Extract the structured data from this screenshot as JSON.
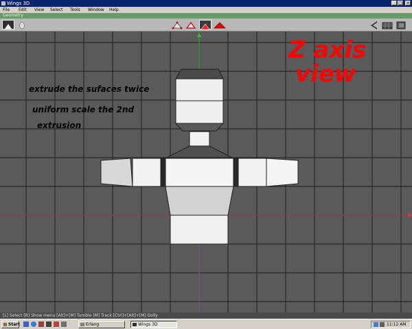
{
  "window": {
    "title": "Wings 3D",
    "minimize_glyph": "_",
    "maximize_glyph": "□",
    "close_glyph": "×"
  },
  "menubar": {
    "items": [
      "File",
      "Edit",
      "View",
      "Select",
      "Tools",
      "Window",
      "Help"
    ]
  },
  "geometry_bar": {
    "label": "Geometry"
  },
  "toolbar": {
    "icons": [
      "undo-icon",
      "smooth-preview-icon",
      "vertex-select-icon",
      "edge-select-icon",
      "face-select-icon",
      "body-select-icon",
      "perspective-toggle-icon",
      "ortho-view-icon",
      "workmode-icon"
    ]
  },
  "viewport": {
    "view_label_line1": "Z axis",
    "view_label_line2": "view",
    "annotation_1": "extrude the sufaces twice",
    "annotation_2_line1": "uniform scale the 2nd",
    "annotation_2_line2": "extrusion",
    "colors": {
      "view_label": "#ff0000",
      "background": "#5a5a5a",
      "grid": "#1e1e1e"
    }
  },
  "statusbar": {
    "text": "[L] Select  [R] Show menu  [Alt]+[M] Tumble  [M] Track  [Ctrl]+[Alt]+[M] Dolly"
  },
  "taskbar": {
    "start_label": "Start",
    "tasks": [
      "Erlang",
      "Wings 3D"
    ],
    "clock": "11:12 AM"
  }
}
